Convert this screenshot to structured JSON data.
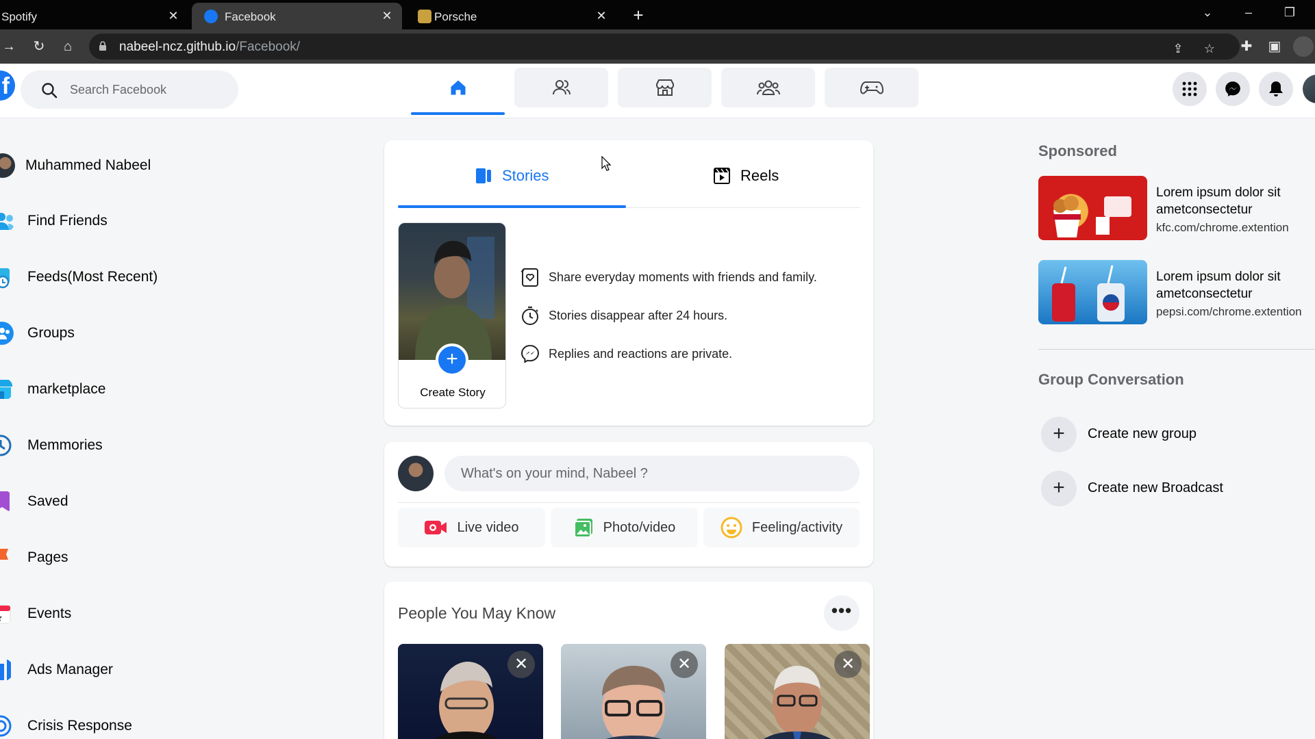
{
  "browser": {
    "tabs": [
      {
        "title": "Spotify",
        "active": false
      },
      {
        "title": "Facebook",
        "active": true
      },
      {
        "title": "Porsche",
        "active": false
      }
    ],
    "close_glyph": "✕",
    "new_tab_glyph": "+",
    "url_host": "nabeel-ncz.github.io",
    "url_path": "/Facebook/"
  },
  "header": {
    "logo_letter": "f",
    "search_placeholder": "Search Facebook",
    "nav_tabs": [
      "home-icon",
      "friends-icon",
      "marketplace-icon",
      "groups-icon",
      "gaming-icon"
    ],
    "right_icons": [
      "menu-grid-icon",
      "messenger-icon",
      "notifications-icon"
    ]
  },
  "sidebar": {
    "items": [
      {
        "label": "Muhammed Nabeel",
        "icon": "profile-avatar"
      },
      {
        "label": "Find Friends",
        "icon": "friends-icon"
      },
      {
        "label": "Feeds(Most Recent)",
        "icon": "feeds-icon"
      },
      {
        "label": "Groups",
        "icon": "groups-icon"
      },
      {
        "label": "marketplace",
        "icon": "marketplace-icon"
      },
      {
        "label": "Memmories",
        "icon": "memories-icon"
      },
      {
        "label": "Saved",
        "icon": "saved-icon"
      },
      {
        "label": "Pages",
        "icon": "pages-icon"
      },
      {
        "label": "Events",
        "icon": "events-icon"
      },
      {
        "label": "Ads Manager",
        "icon": "ads-manager-icon"
      },
      {
        "label": "Crisis Response",
        "icon": "crisis-response-icon"
      }
    ]
  },
  "stories": {
    "tabs": [
      {
        "label": "Stories",
        "icon": "stories-icon",
        "active": true
      },
      {
        "label": "Reels",
        "icon": "reels-icon",
        "active": false
      }
    ],
    "create_label": "Create Story",
    "create_plus": "+",
    "info": [
      {
        "text": "Share everyday moments with friends and family.",
        "icon": "share-moments-icon"
      },
      {
        "text": "Stories disappear after 24 hours.",
        "icon": "timer-icon"
      },
      {
        "text": "Replies and reactions are private.",
        "icon": "messenger-icon"
      }
    ]
  },
  "composer": {
    "placeholder": "What's on your mind, Nabeel ?",
    "actions": [
      {
        "label": "Live video",
        "icon": "live-video-icon"
      },
      {
        "label": "Photo/video",
        "icon": "photo-video-icon"
      },
      {
        "label": "Feeling/activity",
        "icon": "feeling-icon"
      }
    ]
  },
  "people": {
    "title": "People You May Know",
    "more_glyph": "•••",
    "dismiss_glyph": "✕",
    "count_visible": 3
  },
  "right_sidebar": {
    "sponsored_title": "Sponsored",
    "ads": [
      {
        "title": "Lorem ipsum dolor sit ametconsectetur",
        "url": "kfc.com/chrome.extention"
      },
      {
        "title": "Lorem ipsum dolor sit ametconsectetur",
        "url": "pepsi.com/chrome.extention"
      }
    ],
    "group_title": "Group Conversation",
    "group_actions": [
      {
        "label": "Create new group",
        "glyph": "+"
      },
      {
        "label": "Create new Broadcast",
        "glyph": "+"
      }
    ]
  },
  "colors": {
    "brand": "#1877f2",
    "live_red": "#f02849",
    "photo_green": "#45bd62",
    "feeling_yellow": "#f7b928"
  }
}
